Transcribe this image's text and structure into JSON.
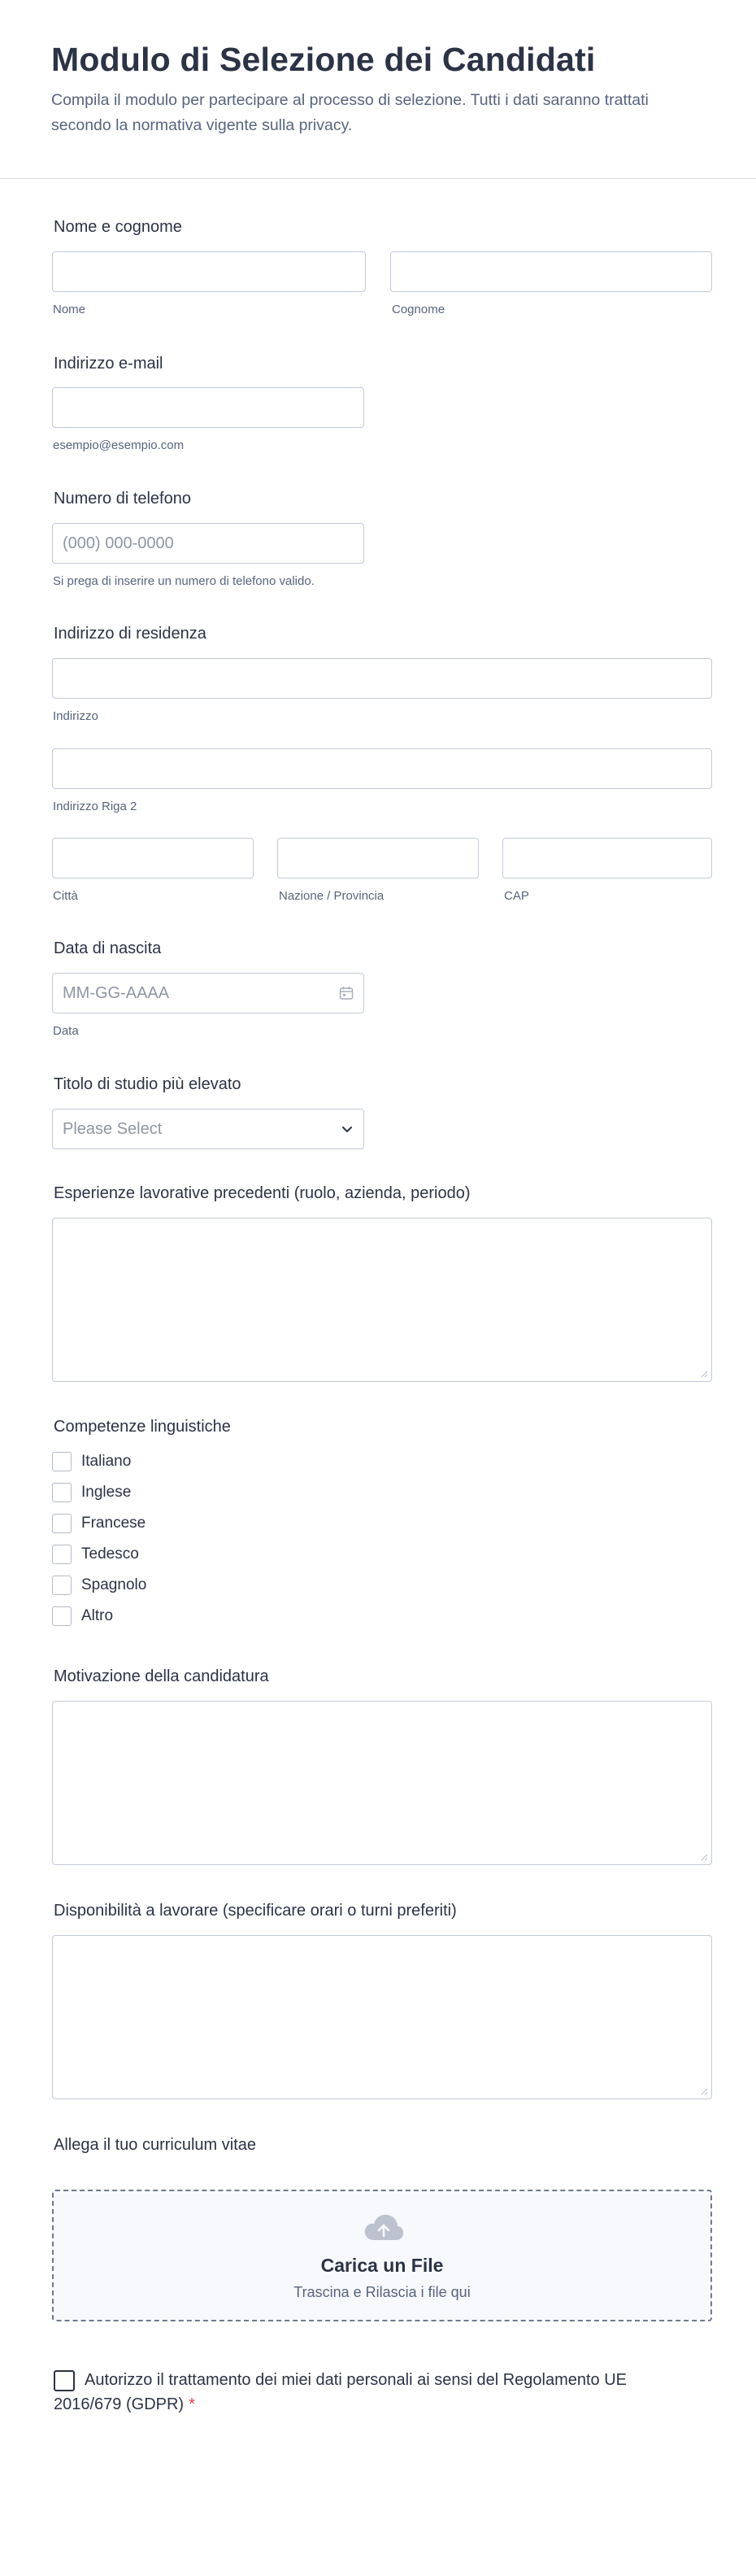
{
  "header": {
    "title": "Modulo di Selezione dei Candidati",
    "description": "Compila il modulo per partecipare al processo di selezione. Tutti i dati saranno trattati secondo la normativa vigente sulla privacy."
  },
  "fields": {
    "name": {
      "label": "Nome e cognome",
      "first_sub": "Nome",
      "last_sub": "Cognome"
    },
    "email": {
      "label": "Indirizzo e-mail",
      "sub": "esempio@esempio.com"
    },
    "phone": {
      "label": "Numero di telefono",
      "placeholder": "(000) 000-0000",
      "sub": "Si prega di inserire un numero di telefono valido."
    },
    "address": {
      "label": "Indirizzo di residenza",
      "line1_sub": "Indirizzo",
      "line2_sub": "Indirizzo Riga 2",
      "city_sub": "Città",
      "state_sub": "Nazione / Provincia",
      "zip_sub": "CAP"
    },
    "birthdate": {
      "label": "Data di nascita",
      "placeholder": "MM-GG-AAAA",
      "sub": "Data"
    },
    "education": {
      "label": "Titolo di studio più elevato",
      "selected": "Please Select"
    },
    "experience": {
      "label": "Esperienze lavorative precedenti (ruolo, azienda, periodo)"
    },
    "languages": {
      "label": "Competenze linguistiche",
      "options": [
        "Italiano",
        "Inglese",
        "Francese",
        "Tedesco",
        "Spagnolo",
        "Altro"
      ]
    },
    "motivation": {
      "label": "Motivazione della candidatura"
    },
    "availability": {
      "label": "Disponibilità a lavorare (specificare orari o turni preferiti)"
    },
    "cv": {
      "label": "Allega il tuo curriculum vitae",
      "title": "Carica un File",
      "subtitle": "Trascina e Rilascia i file qui"
    },
    "consent": {
      "text": "Autorizzo il trattamento dei miei dati personali ai sensi del Regolamento UE 2016/679 (GDPR)",
      "required_mark": "*"
    }
  },
  "colors": {
    "text": "#2c3345",
    "muted": "#57647e",
    "border": "#c3cad8",
    "required": "#f23a3c"
  }
}
